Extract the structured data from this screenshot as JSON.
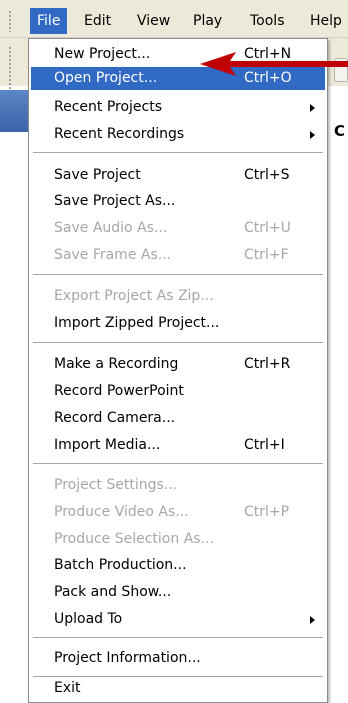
{
  "menubar": {
    "items": [
      {
        "label": "File"
      },
      {
        "label": "Edit"
      },
      {
        "label": "View"
      },
      {
        "label": "Play"
      },
      {
        "label": "Tools"
      },
      {
        "label": "Help"
      }
    ]
  },
  "background": {
    "fragment_text": "C"
  },
  "file_menu": {
    "items": [
      {
        "label": "New Project...",
        "shortcut": "Ctrl+N"
      },
      {
        "label": "Open Project...",
        "shortcut": "Ctrl+O"
      },
      {
        "label": "Recent Projects"
      },
      {
        "label": "Recent Recordings"
      },
      {
        "label": "Save Project",
        "shortcut": "Ctrl+S"
      },
      {
        "label": "Save Project As..."
      },
      {
        "label": "Save Audio As...",
        "shortcut": "Ctrl+U"
      },
      {
        "label": "Save Frame As...",
        "shortcut": "Ctrl+F"
      },
      {
        "label": "Export Project As Zip..."
      },
      {
        "label": "Import Zipped Project..."
      },
      {
        "label": "Make a Recording",
        "shortcut": "Ctrl+R"
      },
      {
        "label": "Record PowerPoint"
      },
      {
        "label": "Record Camera..."
      },
      {
        "label": "Import Media...",
        "shortcut": "Ctrl+I"
      },
      {
        "label": "Project Settings..."
      },
      {
        "label": "Produce Video As...",
        "shortcut": "Ctrl+P"
      },
      {
        "label": "Produce Selection As..."
      },
      {
        "label": "Batch Production..."
      },
      {
        "label": "Pack and Show..."
      },
      {
        "label": "Upload To"
      },
      {
        "label": "Project Information..."
      },
      {
        "label": "Exit"
      }
    ]
  },
  "colors": {
    "highlight": "#316ac5",
    "disabled_text": "#a7a7a7",
    "annotation_arrow": "#c00000"
  },
  "icons": {
    "submenu": "submenu-arrow-icon",
    "annotation": "red-pointer-arrow-icon"
  }
}
